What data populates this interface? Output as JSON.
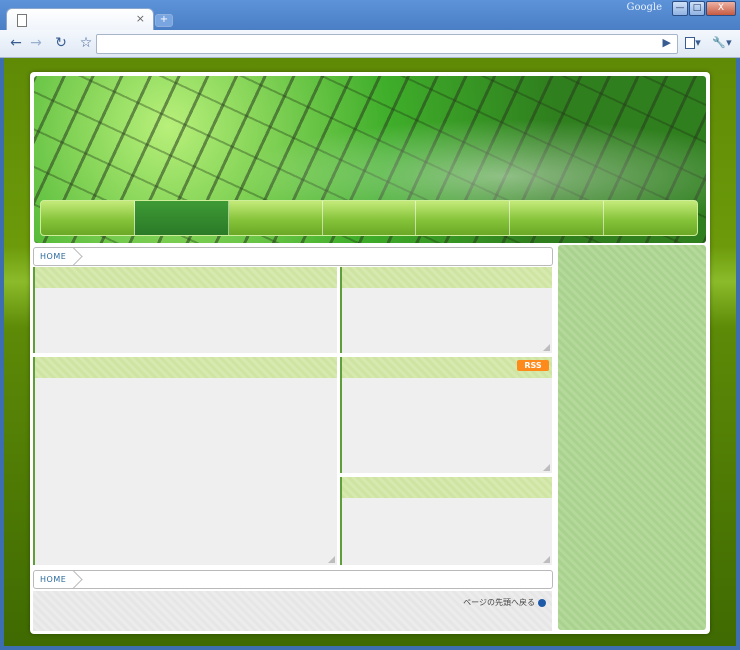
{
  "browser": {
    "brand": "Google",
    "tab_close": "×",
    "new_tab": "+",
    "window_buttons": {
      "minimize": "—",
      "maximize": "□",
      "close": "X"
    },
    "nav": {
      "back": "←",
      "forward": "→",
      "reload": "↻",
      "star": "☆",
      "go": "▶",
      "page_menu": "▾",
      "tools_menu": "▾"
    },
    "address": ""
  },
  "site": {
    "nav_items": [
      "",
      "",
      "",
      "",
      "",
      "",
      ""
    ],
    "active_nav_index": 1,
    "breadcrumb_top": "HOME",
    "breadcrumb_bottom": "HOME",
    "rss_label": "RSS",
    "back_to_top": "ページの先頭へ戻る"
  },
  "colors": {
    "page_green": "#5d8a07",
    "panel_header": "#cfe4a3",
    "sidebar": "#a9d28e",
    "rss": "#ff8a1c",
    "link_blue": "#2b6a9b"
  }
}
